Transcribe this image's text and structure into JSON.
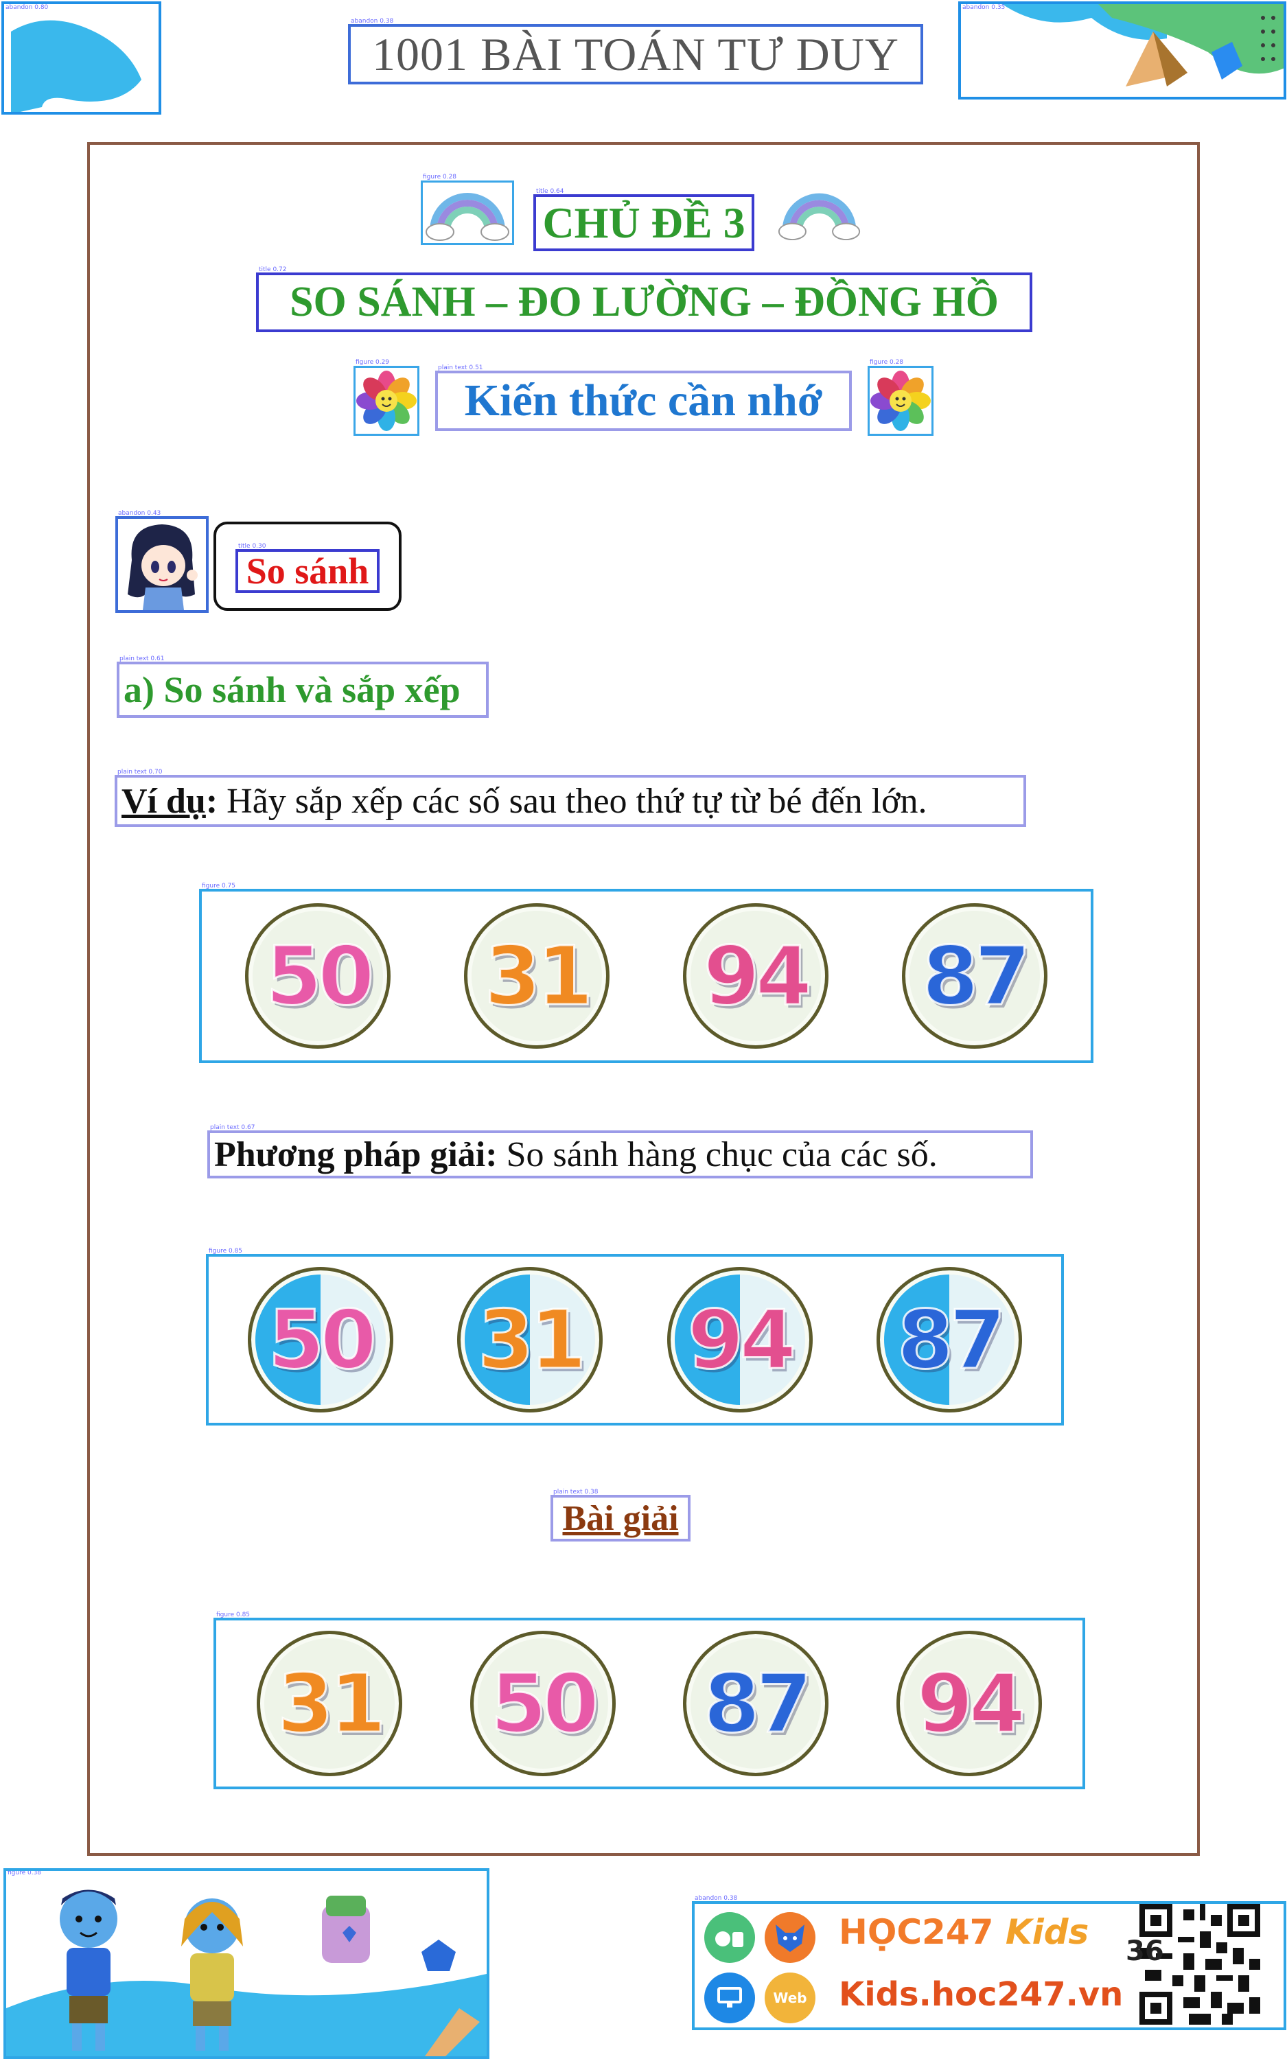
{
  "header": {
    "title": "1001 BÀI TOÁN TƯ DUY",
    "title_detect_label": "abandon 0.38",
    "corner_left_detect_label": "abandon 0.80",
    "corner_right_detect_label": "abandon 0.35"
  },
  "topic": {
    "label": "CHỦ ĐỀ 3",
    "label_detect": "title 0.64",
    "title": "SO SÁNH – ĐO LƯỜNG – ĐỒNG HỒ",
    "title_detect": "title 0.72",
    "rainbow_detect": "figure 0.28",
    "knowledge": "Kiến thức cần nhớ",
    "knowledge_detect": "plain text 0.51",
    "flower_left_detect": "figure 0.29",
    "flower_right_detect": "figure 0.28"
  },
  "section": {
    "girl_detect": "abandon 0.43",
    "compare_label": "So sánh",
    "compare_detect": "title 0.30",
    "subheading": "a) So sánh và sắp xếp",
    "subheading_detect": "plain text 0.61"
  },
  "example": {
    "detect": "plain text 0.70",
    "label": "Ví dụ",
    "colon": ":",
    "text": " Hãy sắp xếp các số sau theo thứ tự từ bé đến lớn."
  },
  "method": {
    "detect": "plain text 0.67",
    "label": "Phương pháp giải:",
    "text": " So sánh hàng chục của các số."
  },
  "solution": {
    "detect": "plain text 0.38",
    "label": "Bài giải"
  },
  "rows": {
    "original": {
      "detect": "figure 0.75",
      "numbers": [
        "50",
        "31",
        "94",
        "87"
      ]
    },
    "method": {
      "detect": "figure 0.85",
      "numbers": [
        "50",
        "31",
        "94",
        "87"
      ]
    },
    "answer": {
      "detect": "figure 0.85",
      "numbers": [
        "31",
        "50",
        "87",
        "94"
      ]
    }
  },
  "number_colors": {
    "50": "#e85aa8",
    "31": "#f08a22",
    "94": "#e34f8f",
    "87": "#2a66d8"
  },
  "footer": {
    "kids_detect": "figure 0.38",
    "brand_detect": "abandon 0.38",
    "brand_name": "HỌC247",
    "brand_kids": "Kids",
    "brand_url": "Kids.hoc247.vn",
    "web_badge": "Web",
    "page_number": "36"
  },
  "colors": {
    "accent_blue": "#3d6cd8",
    "title_green": "#2e9a2e",
    "frame_brown": "#8a5a45",
    "red": "#e01818"
  }
}
